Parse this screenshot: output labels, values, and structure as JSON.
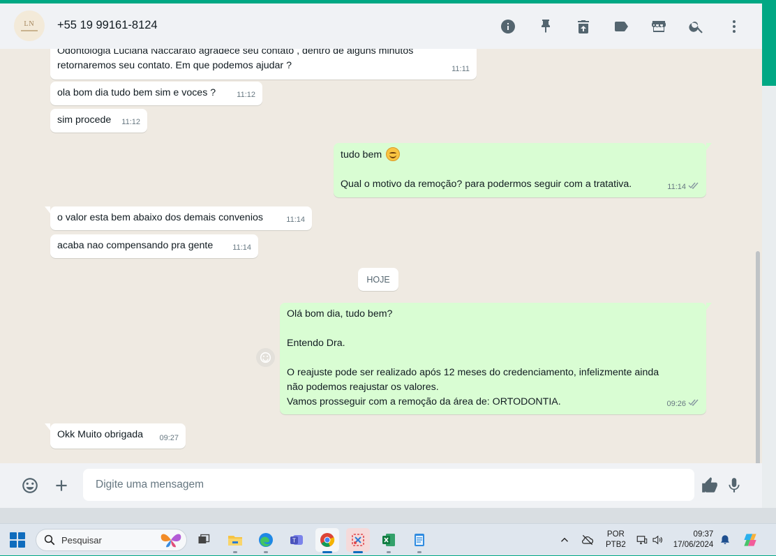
{
  "header": {
    "contact_name": "+55 19 99161-8124",
    "avatar_monogram": "LN",
    "icons": [
      "info-icon",
      "pin-icon",
      "delete-icon",
      "label-icon",
      "store-icon",
      "search-icon",
      "menu-icon"
    ]
  },
  "chat": {
    "messages": [
      {
        "dir": "in",
        "lines": [
          "Odontologia Luciana Naccarato agradece seu contato , dentro de alguns minutos",
          "retornaremos seu contato. Em que podemos ajudar ?"
        ],
        "time": "11:11"
      },
      {
        "dir": "in",
        "lines": [
          "ola bom dia tudo bem sim e voces ?"
        ],
        "time": "11:12"
      },
      {
        "dir": "in",
        "lines": [
          "sim procede"
        ],
        "time": "11:12"
      },
      {
        "dir": "out",
        "lines": [
          "tudo bem",
          "",
          "Qual o motivo da remoção? para podermos seguir com a tratativa."
        ],
        "time": "11:14"
      },
      {
        "dir": "in",
        "lines": [
          "o valor esta bem abaixo dos demais convenios"
        ],
        "time": "11:14"
      },
      {
        "dir": "in",
        "lines": [
          "acaba nao compensando pra gente"
        ],
        "time": "11:14"
      },
      {
        "dir": "out",
        "lines": [
          "Olá bom dia, tudo bem?",
          "",
          "Entendo Dra.",
          "",
          "O reajuste pode ser realizado após 12 meses do credenciamento, infelizmente ainda",
          "não podemos reajustar os valores.",
          "Vamos prosseguir com a remoção da área de: ORTODONTIA."
        ],
        "time": "09:26"
      },
      {
        "dir": "in",
        "lines": [
          "Okk Muito obrigada"
        ],
        "time": "09:27"
      }
    ],
    "day_divider": "HOJE"
  },
  "composer": {
    "placeholder": "Digite uma mensagem"
  },
  "taskbar": {
    "search_label": "Pesquisar",
    "lang_top": "POR",
    "lang_bottom": "PTB2",
    "clock_time": "09:37",
    "clock_date": "17/06/2024"
  },
  "colors": {
    "accent": "#00a884",
    "outgoing_bubble": "#d9fdd3",
    "incoming_bubble": "#ffffff",
    "chat_bg": "#efeae2"
  }
}
